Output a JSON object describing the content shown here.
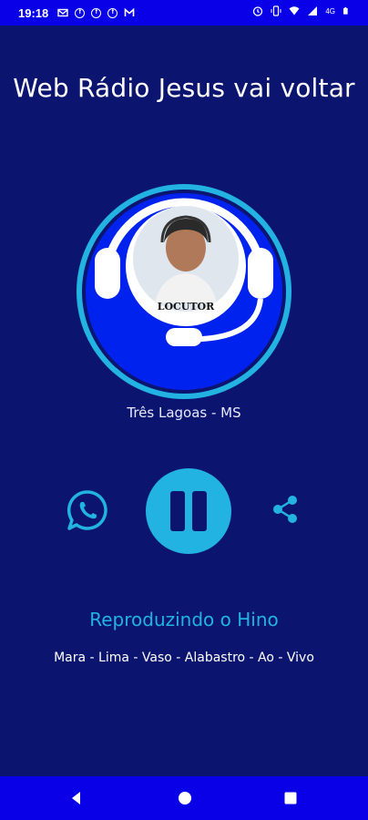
{
  "status_bar": {
    "time": "19:18",
    "notification_icons": [
      "gmail-icon",
      "facebook-icon",
      "facebook-icon",
      "facebook-icon",
      "gmail-icon"
    ],
    "system_icons": [
      "alarm-icon",
      "vibrate-icon",
      "wifi-icon",
      "signal-icon",
      "battery-icon"
    ],
    "network": "4G"
  },
  "app": {
    "title": "Web Rádio Jesus vai voltar",
    "logo_label": "LOCUTOR",
    "location": "Três Lagoas - MS"
  },
  "player": {
    "state": "playing",
    "status_text": "Reproduzindo o Hino",
    "track": "Mara - Lima - Vaso - Alabastro - Ao - Vivo"
  },
  "colors": {
    "background": "#0b1570",
    "status_bar": "#0a00e8",
    "accent": "#22b3e3",
    "logo_inner": "#0022ee"
  },
  "nav": {
    "buttons": [
      "back-icon",
      "home-icon",
      "recent-apps-icon"
    ]
  }
}
